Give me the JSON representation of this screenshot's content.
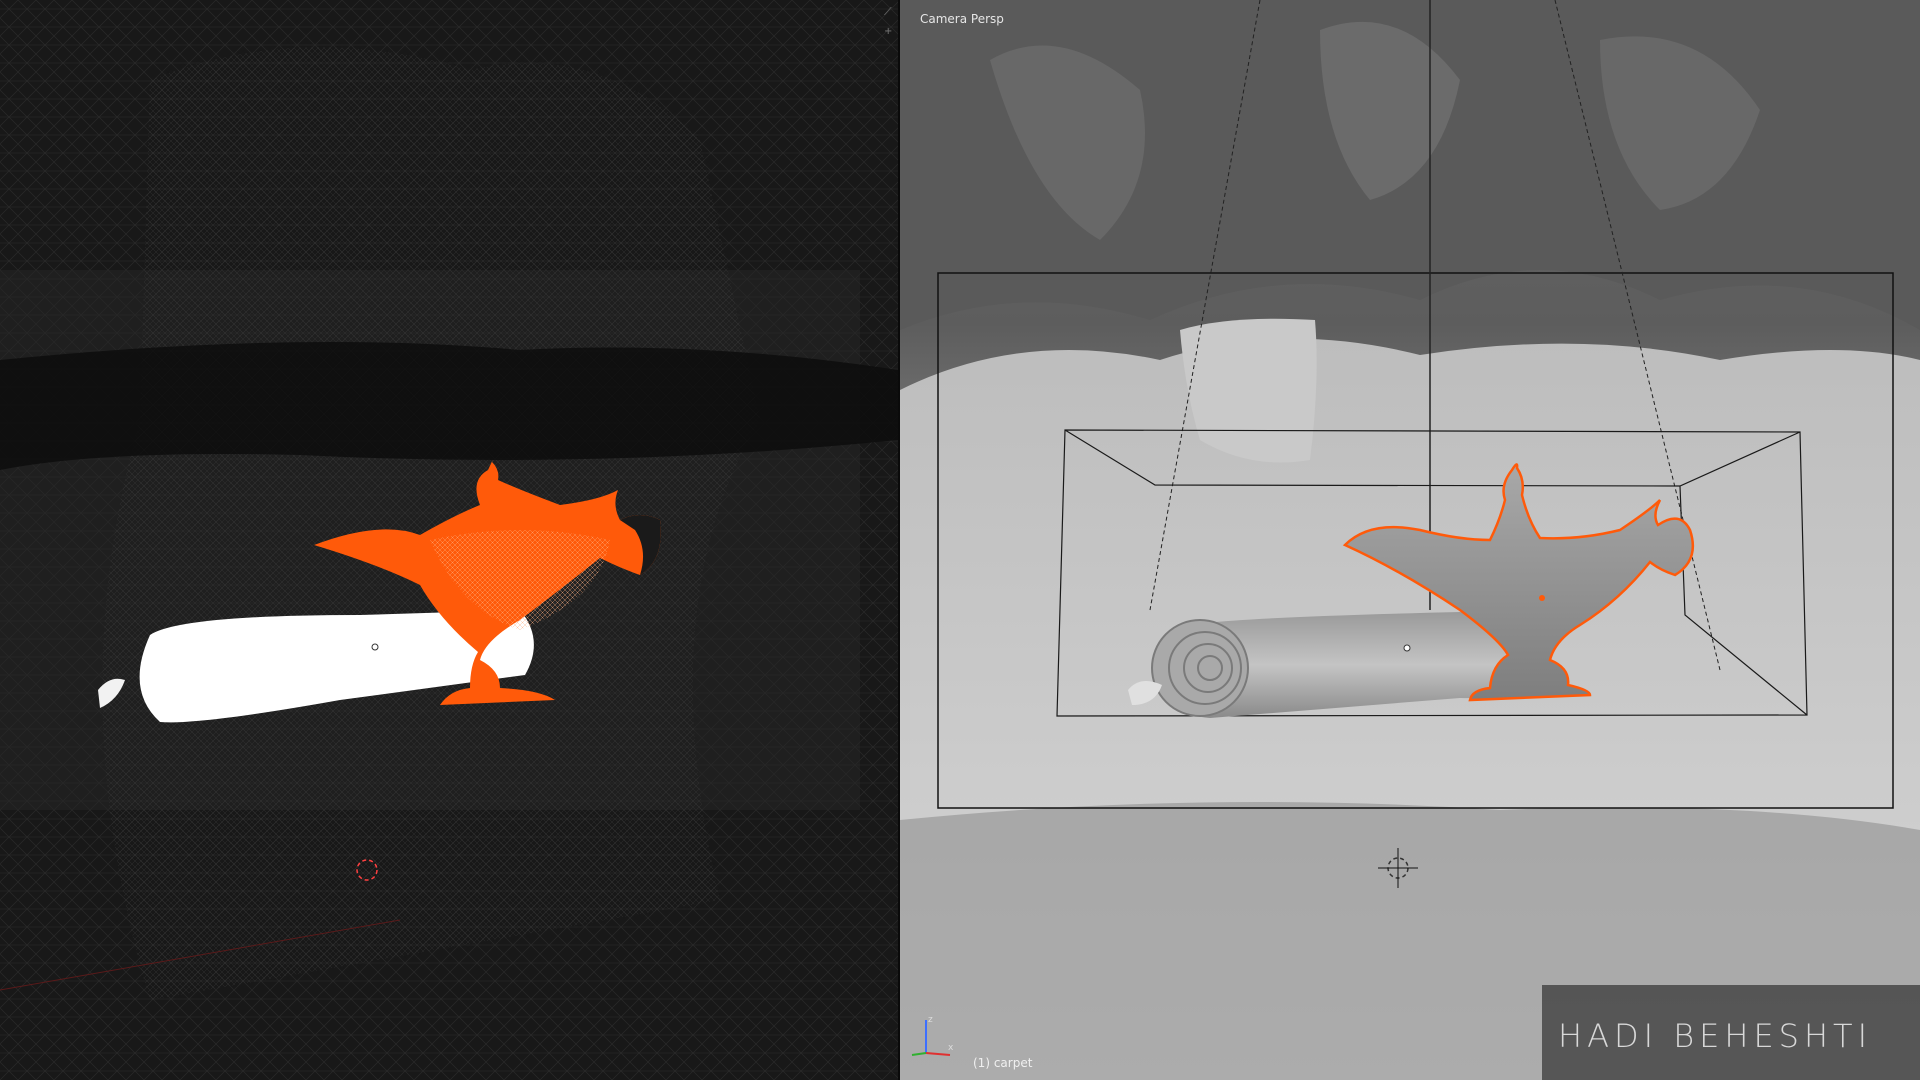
{
  "viewport_right": {
    "title": "Camera Persp",
    "active_object": "(1) carpet"
  },
  "watermark": {
    "text": "HADI BEHESHTI"
  },
  "colors": {
    "selection_orange": "#ff5a0a",
    "scroll_white": "#ffffff",
    "wire_dark": "#151515",
    "solid_gray": "#8a8a8a"
  }
}
